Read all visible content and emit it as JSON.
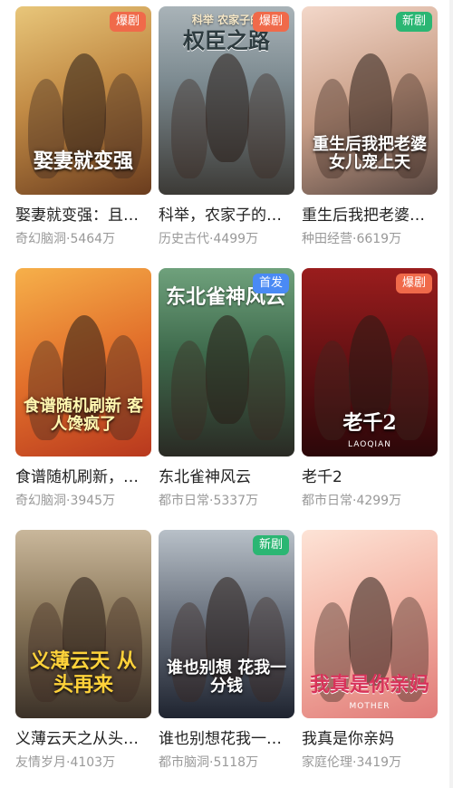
{
  "cards": [
    {
      "title": "娶妻就变强：且看我横扫北蛮",
      "genre": "奇幻脑洞",
      "views": "5464万",
      "badge": "爆剧",
      "badge_color": "#f06a4a",
      "poster_text": "娶妻就变强",
      "poster_sub": "",
      "poster_top": "",
      "bg": "linear-gradient(160deg,#e8c67a 0%,#c28b45 45%,#6a3c1e 100%)"
    },
    {
      "title": "科举，农家子的权臣之路",
      "genre": "历史古代",
      "views": "4499万",
      "badge": "爆剧",
      "badge_color": "#f06a4a",
      "poster_text": "权臣之路",
      "poster_sub": "",
      "poster_top": "科举 农家子的",
      "bg": "linear-gradient(180deg,#a9b3b8 0%,#7c8a90 40%,#3c3a36 100%)"
    },
    {
      "title": "重生后我把老婆女儿宠上天",
      "genre": "种田经营",
      "views": "6619万",
      "badge": "新剧",
      "badge_color": "#2bb673",
      "poster_text": "重生后我把老婆 女儿宠上天",
      "poster_sub": "",
      "poster_top": "",
      "bg": "linear-gradient(160deg,#f3d7c9 0%,#caa089 50%,#5b4a44 100%)"
    },
    {
      "title": "食谱随机刷新，客人馋疯了",
      "genre": "奇幻脑洞",
      "views": "3945万",
      "badge": "",
      "badge_color": "",
      "poster_text": "食谱随机刷新 客人馋疯了",
      "poster_sub": "",
      "poster_top": "",
      "bg": "linear-gradient(160deg,#f6b04a 0%,#e2702b 50%,#b8381e 100%)"
    },
    {
      "title": "东北雀神风云",
      "genre": "都市日常",
      "views": "5337万",
      "badge": "首发",
      "badge_color": "#4a8af4",
      "poster_text": "",
      "poster_sub": "",
      "poster_top": "东北雀神风云",
      "bg": "linear-gradient(180deg,#6fa17c 0%,#3e6a4c 45%,#2a2a24 100%)"
    },
    {
      "title": "老千2",
      "genre": "都市日常",
      "views": "4299万",
      "badge": "爆剧",
      "badge_color": "#f06a4a",
      "poster_text": "老千2",
      "poster_sub": "LAOQIAN",
      "poster_top": "",
      "bg": "linear-gradient(180deg,#9a1d1d 0%,#5e0f12 55%,#2b0709 100%)"
    },
    {
      "title": "义薄云天之从头再来",
      "genre": "友情岁月",
      "views": "4103万",
      "badge": "",
      "badge_color": "",
      "poster_text": "义薄云天 从头再来",
      "poster_sub": "",
      "poster_top": "",
      "bg": "linear-gradient(180deg,#c9b79b 0%,#8d7a5c 45%,#3b3128 100%)"
    },
    {
      "title": "谁也别想花我一分钱",
      "genre": "都市脑洞",
      "views": "5118万",
      "badge": "新剧",
      "badge_color": "#2bb673",
      "poster_text": "谁也别想 花我一分钱",
      "poster_sub": "",
      "poster_top": "",
      "bg": "linear-gradient(180deg,#b8c0c8 0%,#6c7480 45%,#1f2430 100%)"
    },
    {
      "title": "我真是你亲妈",
      "genre": "家庭伦理",
      "views": "3419万",
      "badge": "",
      "badge_color": "",
      "poster_text": "我真是你亲妈",
      "poster_sub": "MOTHER",
      "poster_top": "",
      "bg": "linear-gradient(160deg,#fde3d6 0%,#f4b3a4 50%,#e07a78 100%)"
    }
  ]
}
